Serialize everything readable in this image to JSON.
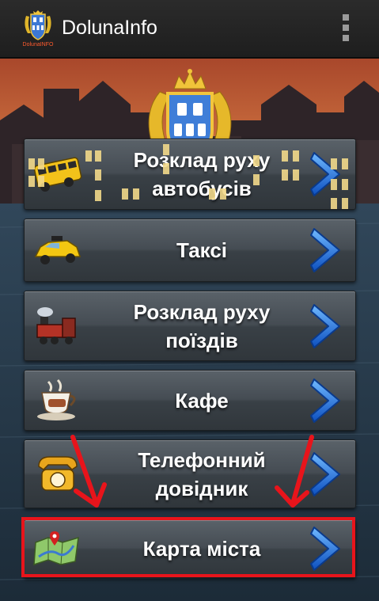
{
  "app": {
    "title": "DolunaInfo",
    "logo_caption": "DolunaINFO",
    "logo_icon": "coat-of-arms-icon",
    "overflow_icon": "overflow-menu-icon"
  },
  "menu": [
    {
      "id": "bus",
      "label": "Розклад руху\nавтобусів",
      "icon": "bus-icon"
    },
    {
      "id": "taxi",
      "label": "Таксі",
      "icon": "taxi-icon"
    },
    {
      "id": "train",
      "label": "Розклад руху\nпоїздів",
      "icon": "train-icon"
    },
    {
      "id": "cafe",
      "label": "Кафе",
      "icon": "cafe-icon"
    },
    {
      "id": "phone",
      "label": "Телефонний\nдовідник",
      "icon": "phone-icon"
    },
    {
      "id": "map",
      "label": "Карта міста",
      "icon": "map-icon"
    }
  ],
  "chevron_icon": "chevron-right-icon",
  "colors": {
    "actionbar": "#222222",
    "annotation_red": "#e8141b",
    "chevron_blue": "#1e6fe0",
    "sky_top": "#b24a2a",
    "water": "#2b3f50"
  }
}
